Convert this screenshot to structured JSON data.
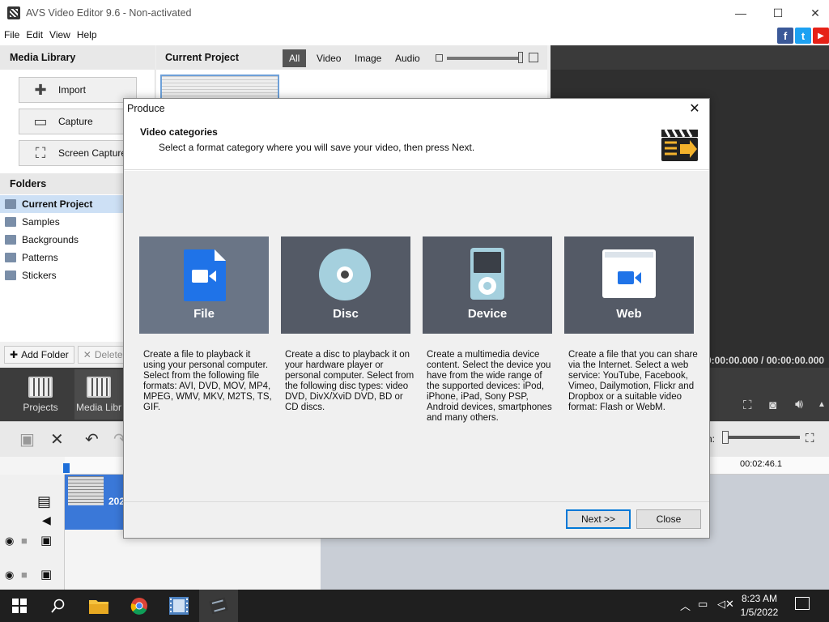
{
  "window": {
    "title": "AVS Video Editor 9.6 - Non-activated",
    "minimize": "—",
    "maximize": "☐",
    "close": "✕"
  },
  "menu": [
    "File",
    "Edit",
    "View",
    "Help"
  ],
  "social": {
    "facebook": "f",
    "twitter": "t",
    "youtube": "▶",
    "colors": {
      "facebook": "#3b5998",
      "twitter": "#1da1f2",
      "youtube": "#e62117"
    }
  },
  "media_library": {
    "title": "Media Library",
    "buttons": [
      "Import",
      "Capture",
      "Screen Capture"
    ],
    "folders_title": "Folders",
    "folders": [
      "Current Project",
      "Samples",
      "Backgrounds",
      "Patterns",
      "Stickers"
    ],
    "add_folder": "Add Folder",
    "delete": "Delete"
  },
  "project": {
    "title": "Current Project",
    "filters": [
      "All",
      "Video",
      "Image",
      "Audio"
    ]
  },
  "preview": {
    "time": "0:00:00.000 / 00:00:00.000"
  },
  "modes": [
    "Projects",
    "Media Libr"
  ],
  "timeline": {
    "time_label": "00:02:46.1",
    "zoom_label": "n:",
    "clip_label": "202"
  },
  "dialog": {
    "title": "Produce",
    "heading": "Video categories",
    "subheading": "Select a format category where you will save your video, then press Next.",
    "categories": [
      {
        "name": "File",
        "desc": "Create a file to playback it using your personal computer. Select from the following file formats: AVI, DVD, MOV, MP4, MPEG, WMV, MKV, M2TS, TS, GIF."
      },
      {
        "name": "Disc",
        "desc": "Create a disc to playback it on your hardware player or personal computer. Select from the following disc types: video DVD, DivX/XviD DVD, BD or CD discs."
      },
      {
        "name": "Device",
        "desc": "Create a multimedia device content. Select the device you have from the wide range of the supported devices: iPod, iPhone, iPad, Sony PSP, Android devices, smartphones and many others."
      },
      {
        "name": "Web",
        "desc": "Create a file that you can share via the Internet. Select a web service: YouTube, Facebook, Vimeo, Dailymotion, Flickr and Dropbox or a suitable video format: Flash or WebM."
      }
    ],
    "next": "Next >>",
    "close": "Close"
  },
  "taskbar": {
    "time": "8:23 AM",
    "date": "1/5/2022"
  }
}
